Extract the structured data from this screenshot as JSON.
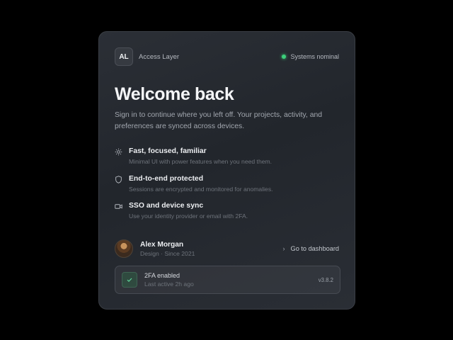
{
  "header": {
    "logo_text": "AL",
    "brand": "Access Layer",
    "status": "Systems nominal",
    "status_color": "#3ccf7a"
  },
  "title": "Welcome back",
  "subtitle": "Sign in to continue where you left off. Your projects, activity, and preferences are synced across devices.",
  "features": [
    {
      "icon": "sun-icon",
      "title": "Fast, focused, familiar",
      "desc": "Minimal UI with power features when you need them."
    },
    {
      "icon": "shield-icon",
      "title": "End-to-end protected",
      "desc": "Sessions are encrypted and monitored for anomalies."
    },
    {
      "icon": "video-icon",
      "title": "SSO and device sync",
      "desc": "Use your identity provider or email with 2FA."
    }
  ],
  "user": {
    "name": "Alex Morgan",
    "role": "Design · Since 2021",
    "dashboard_label": "Go to dashboard"
  },
  "twofa": {
    "title": "2FA enabled",
    "subtitle": "Last active 2h ago",
    "version": "v3.8.2"
  }
}
